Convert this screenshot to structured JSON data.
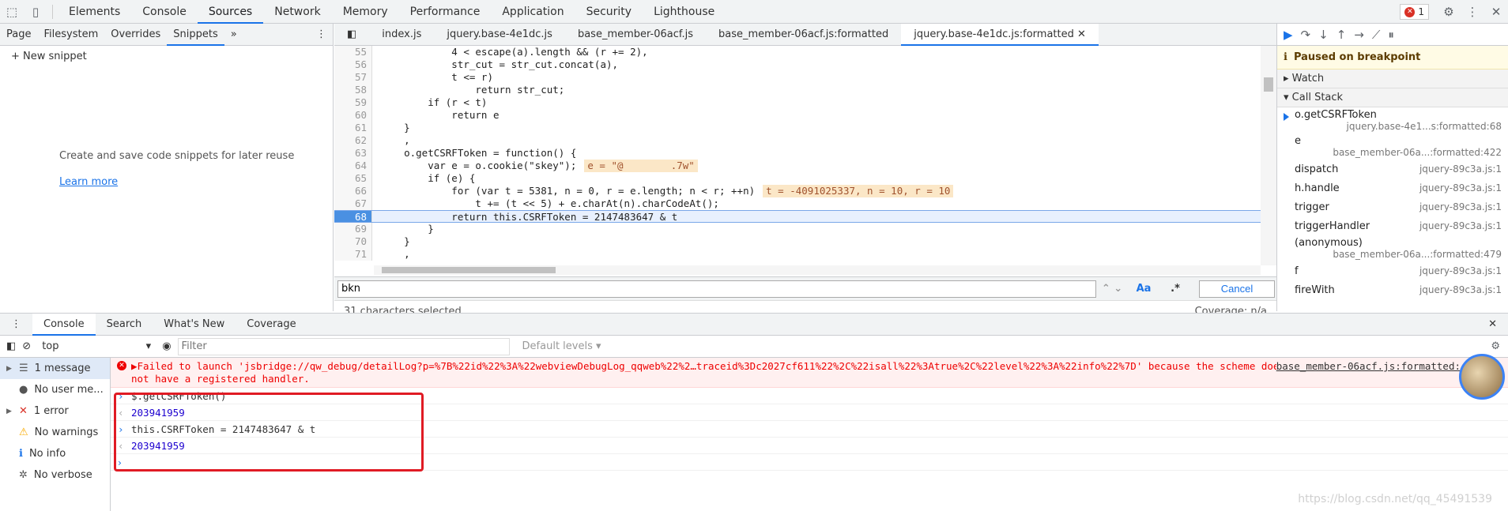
{
  "topbar": {
    "tabs": [
      "Elements",
      "Console",
      "Sources",
      "Network",
      "Memory",
      "Performance",
      "Application",
      "Security",
      "Lighthouse"
    ],
    "active_tab": "Sources",
    "error_count": "1"
  },
  "navigator": {
    "tabs": [
      "Page",
      "Filesystem",
      "Overrides",
      "Snippets"
    ],
    "new_snippet": "+ New snippet",
    "empty_text": "Create and save code snippets for later reuse",
    "learn_more": "Learn more"
  },
  "editor": {
    "files": [
      "index.js",
      "jquery.base-4e1dc.js",
      "base_member-06acf.js",
      "base_member-06acf.js:formatted",
      "jquery.base-4e1dc.js:formatted"
    ],
    "lines": [
      {
        "n": "55",
        "t": "            4 < escape(a).length && (r += 2),"
      },
      {
        "n": "56",
        "t": "            str_cut = str_cut.concat(a),"
      },
      {
        "n": "57",
        "t": "            t <= r)"
      },
      {
        "n": "58",
        "t": "                return str_cut;"
      },
      {
        "n": "59",
        "t": "        if (r < t)"
      },
      {
        "n": "60",
        "t": "            return e"
      },
      {
        "n": "61",
        "t": "    }"
      },
      {
        "n": "62",
        "t": "    ,"
      },
      {
        "n": "63",
        "t": "    o.getCSRFToken = function() {"
      },
      {
        "n": "64",
        "t": "        var e = o.cookie(\"skey\");",
        "inline": "e = \"@        .7w\""
      },
      {
        "n": "65",
        "t": "        if (e) {"
      },
      {
        "n": "66",
        "t": "            for (var t = 5381, n = 0, r = e.length; n < r; ++n)",
        "inline": "t = -4091025337, n = 10, r = 10"
      },
      {
        "n": "67",
        "t": "                t += (t << 5) + e.charAt(n).charCodeAt();"
      },
      {
        "n": "68",
        "t": "            return this.CSRFToken = 2147483647 & t"
      },
      {
        "n": "69",
        "t": "        }"
      },
      {
        "n": "70",
        "t": "    }"
      },
      {
        "n": "71",
        "t": "    ,"
      }
    ],
    "search_value": "bkn",
    "cancel_label": "Cancel",
    "selection_status": "31 characters selected",
    "coverage": "Coverage: n/a"
  },
  "debugger": {
    "paused": "Paused on breakpoint",
    "watch": "Watch",
    "call_stack": "Call Stack",
    "frames": [
      {
        "name": "o.getCSRFToken",
        "loc": "jquery.base-4e1...s:formatted:68",
        "two": true,
        "sel": true
      },
      {
        "name": "e",
        "loc": "base_member-06a...:formatted:422",
        "two": true
      },
      {
        "name": "dispatch",
        "loc": "jquery-89c3a.js:1"
      },
      {
        "name": "h.handle",
        "loc": "jquery-89c3a.js:1"
      },
      {
        "name": "trigger",
        "loc": "jquery-89c3a.js:1"
      },
      {
        "name": "triggerHandler",
        "loc": "jquery-89c3a.js:1"
      },
      {
        "name": "(anonymous)",
        "loc": "base_member-06a...:formatted:479",
        "two": true
      },
      {
        "name": "f",
        "loc": "jquery-89c3a.js:1"
      },
      {
        "name": "fireWith",
        "loc": "jquery-89c3a.js:1"
      }
    ]
  },
  "drawer": {
    "tabs": [
      "Console",
      "Search",
      "What's New",
      "Coverage"
    ],
    "context": "top",
    "filter_placeholder": "Filter",
    "levels": "Default levels ▾",
    "sidebar": [
      {
        "label": "1 message",
        "icon": "list-icon"
      },
      {
        "label": "No user me...",
        "icon": "user-icon"
      },
      {
        "label": "1 error",
        "icon": "error-icon"
      },
      {
        "label": "No warnings",
        "icon": "warning-icon"
      },
      {
        "label": "No info",
        "icon": "info-icon"
      },
      {
        "label": "No verbose",
        "icon": "bug-icon"
      }
    ],
    "error_line1": "▶Failed to launch 'jsbridge://qw_debug/detailLog?p=%7B%22id%22%3A%22webviewDebugLog_qqweb%22%2…traceid%3Dc2027cf611%22%2C%22isall%22%3Atrue%2C%22level%22%3A%22info%22%7D' because the scheme does",
    "error_line2": "not have a registered handler.",
    "error_source": "base_member-06acf.js:formatted:",
    "entries": [
      {
        "in": "$.getCSRFToken()",
        "out": "203941959"
      },
      {
        "in": "this.CSRFToken = 2147483647 & t",
        "out": "203941959"
      }
    ]
  },
  "watermark": "https://blog.csdn.net/qq_45491539"
}
